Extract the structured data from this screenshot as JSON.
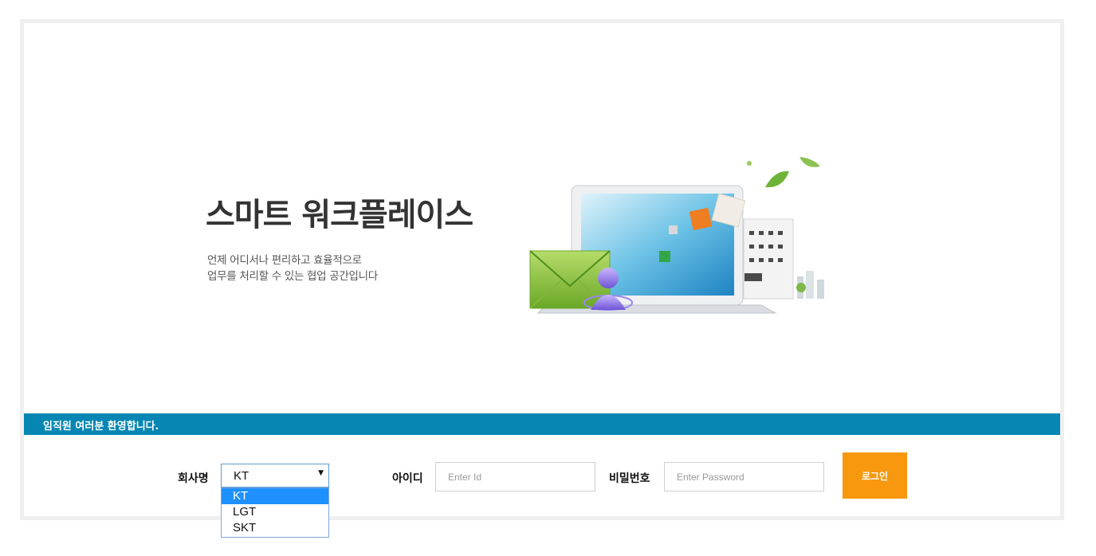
{
  "hero": {
    "title": "스마트 워크플레이스",
    "subtitle_lines": [
      "언제 어디서나 편리하고 효율적으로",
      "업무를 처리할 수 있는 협업 공간입니다"
    ]
  },
  "banner": {
    "text": "임직원 여러분 환영합니다."
  },
  "form": {
    "company_label": "회사명",
    "company_selected": "KT",
    "company_options": [
      "KT",
      "LGT",
      "SKT"
    ],
    "id_label": "아이디",
    "id_placeholder": "Enter Id",
    "password_label": "비밀번호",
    "password_placeholder": "Enter Password",
    "login_button": "로그인"
  },
  "colors": {
    "banner": "#0586b3",
    "login_button": "#f7980f",
    "option_highlight": "#1e90ff"
  }
}
